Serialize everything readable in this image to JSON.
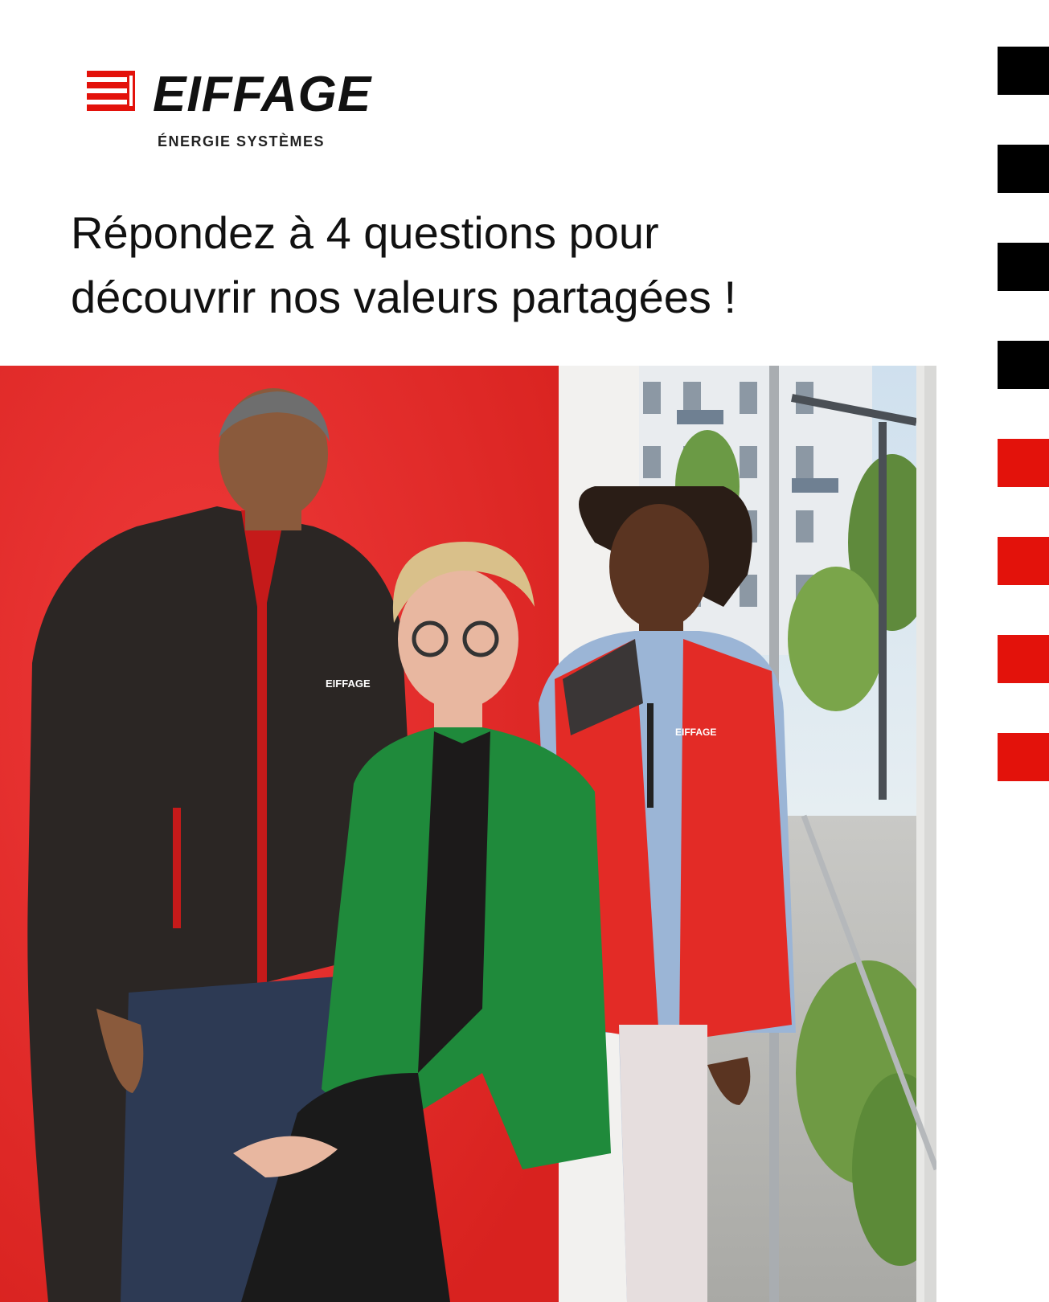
{
  "brand": {
    "name": "EIFFAGE",
    "subtitle": "ÉNERGIE SYSTÈMES",
    "logo_icon": "eiffage-logo-icon",
    "color_red": "#e3120b",
    "color_dark": "#111111"
  },
  "headline": {
    "line1": "Répondez à 4 questions pour",
    "line2": "découvrir nos valeurs partagées !"
  },
  "photo": {
    "jacket_logo_text": "EIFFAGE",
    "vest_logo_text": "EIFFAGE"
  },
  "progress": {
    "total": 8,
    "black_count": 4,
    "red_count": 4,
    "colors": [
      "#000000",
      "#000000",
      "#000000",
      "#000000",
      "#e3120b",
      "#e3120b",
      "#e3120b",
      "#e3120b"
    ]
  }
}
